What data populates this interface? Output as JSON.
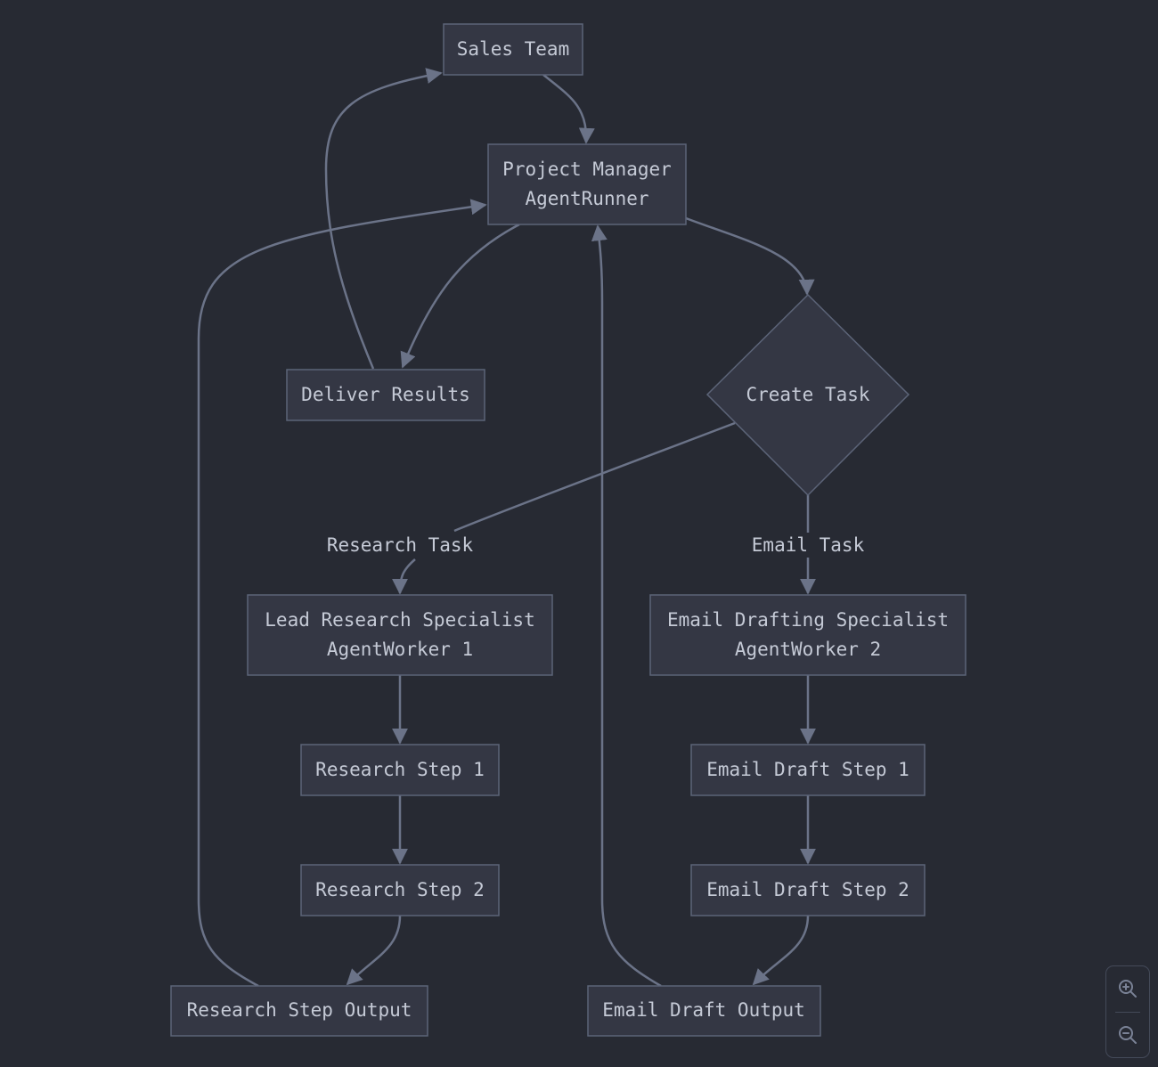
{
  "nodes": {
    "sales_team": {
      "line1": "Sales Team"
    },
    "project_manager": {
      "line1": "Project Manager",
      "line2": "AgentRunner"
    },
    "deliver_results": {
      "line1": "Deliver Results"
    },
    "create_task": {
      "line1": "Create Task"
    },
    "lead_research": {
      "line1": "Lead Research Specialist",
      "line2": "AgentWorker 1"
    },
    "email_drafting": {
      "line1": "Email Drafting Specialist",
      "line2": "AgentWorker 2"
    },
    "research_step_1": {
      "line1": "Research Step 1"
    },
    "research_step_2": {
      "line1": "Research Step 2"
    },
    "research_output": {
      "line1": "Research Step Output"
    },
    "email_step_1": {
      "line1": "Email Draft Step 1"
    },
    "email_step_2": {
      "line1": "Email Draft Step 2"
    },
    "email_output": {
      "line1": "Email Draft Output"
    }
  },
  "edge_labels": {
    "research_task": "Research Task",
    "email_task": "Email Task"
  },
  "edges": [
    {
      "from": "Sales Team",
      "to": "Project Manager AgentRunner"
    },
    {
      "from": "Project Manager AgentRunner",
      "to": "Create Task"
    },
    {
      "from": "Create Task",
      "to": "Lead Research Specialist AgentWorker 1",
      "label": "Research Task"
    },
    {
      "from": "Create Task",
      "to": "Email Drafting Specialist AgentWorker 2",
      "label": "Email Task"
    },
    {
      "from": "Lead Research Specialist AgentWorker 1",
      "to": "Research Step 1"
    },
    {
      "from": "Research Step 1",
      "to": "Research Step 2"
    },
    {
      "from": "Research Step 2",
      "to": "Research Step Output"
    },
    {
      "from": "Email Drafting Specialist AgentWorker 2",
      "to": "Email Draft Step 1"
    },
    {
      "from": "Email Draft Step 1",
      "to": "Email Draft Step 2"
    },
    {
      "from": "Email Draft Step 2",
      "to": "Email Draft Output"
    },
    {
      "from": "Research Step Output",
      "to": "Project Manager AgentRunner"
    },
    {
      "from": "Email Draft Output",
      "to": "Project Manager AgentRunner"
    },
    {
      "from": "Project Manager AgentRunner",
      "to": "Deliver Results"
    },
    {
      "from": "Deliver Results",
      "to": "Sales Team"
    }
  ],
  "controls": {
    "zoom_in": "zoom-in-icon",
    "zoom_out": "zoom-out-icon"
  },
  "colors": {
    "background": "#272a33",
    "node_fill": "#343744",
    "node_stroke": "#5c6478",
    "edge": "#6b7388",
    "text": "#c5cad6"
  }
}
